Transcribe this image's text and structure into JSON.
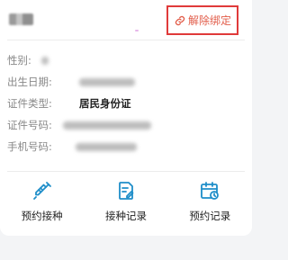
{
  "header": {
    "unbind_label": "解除绑定"
  },
  "info": {
    "gender_label": "性别:",
    "birthdate_label": "出生日期:",
    "id_type_label": "证件类型:",
    "id_type_value": "居民身份证",
    "id_number_label": "证件号码:",
    "phone_label": "手机号码:"
  },
  "actions": [
    {
      "label": "预约接种",
      "icon": "syringe-icon"
    },
    {
      "label": "接种记录",
      "icon": "record-icon"
    },
    {
      "label": "预约记录",
      "icon": "calendar-icon"
    }
  ],
  "colors": {
    "accent": "#1f8ec9",
    "unbind_text": "#e25d4a",
    "highlight_border": "#e03a3a"
  }
}
